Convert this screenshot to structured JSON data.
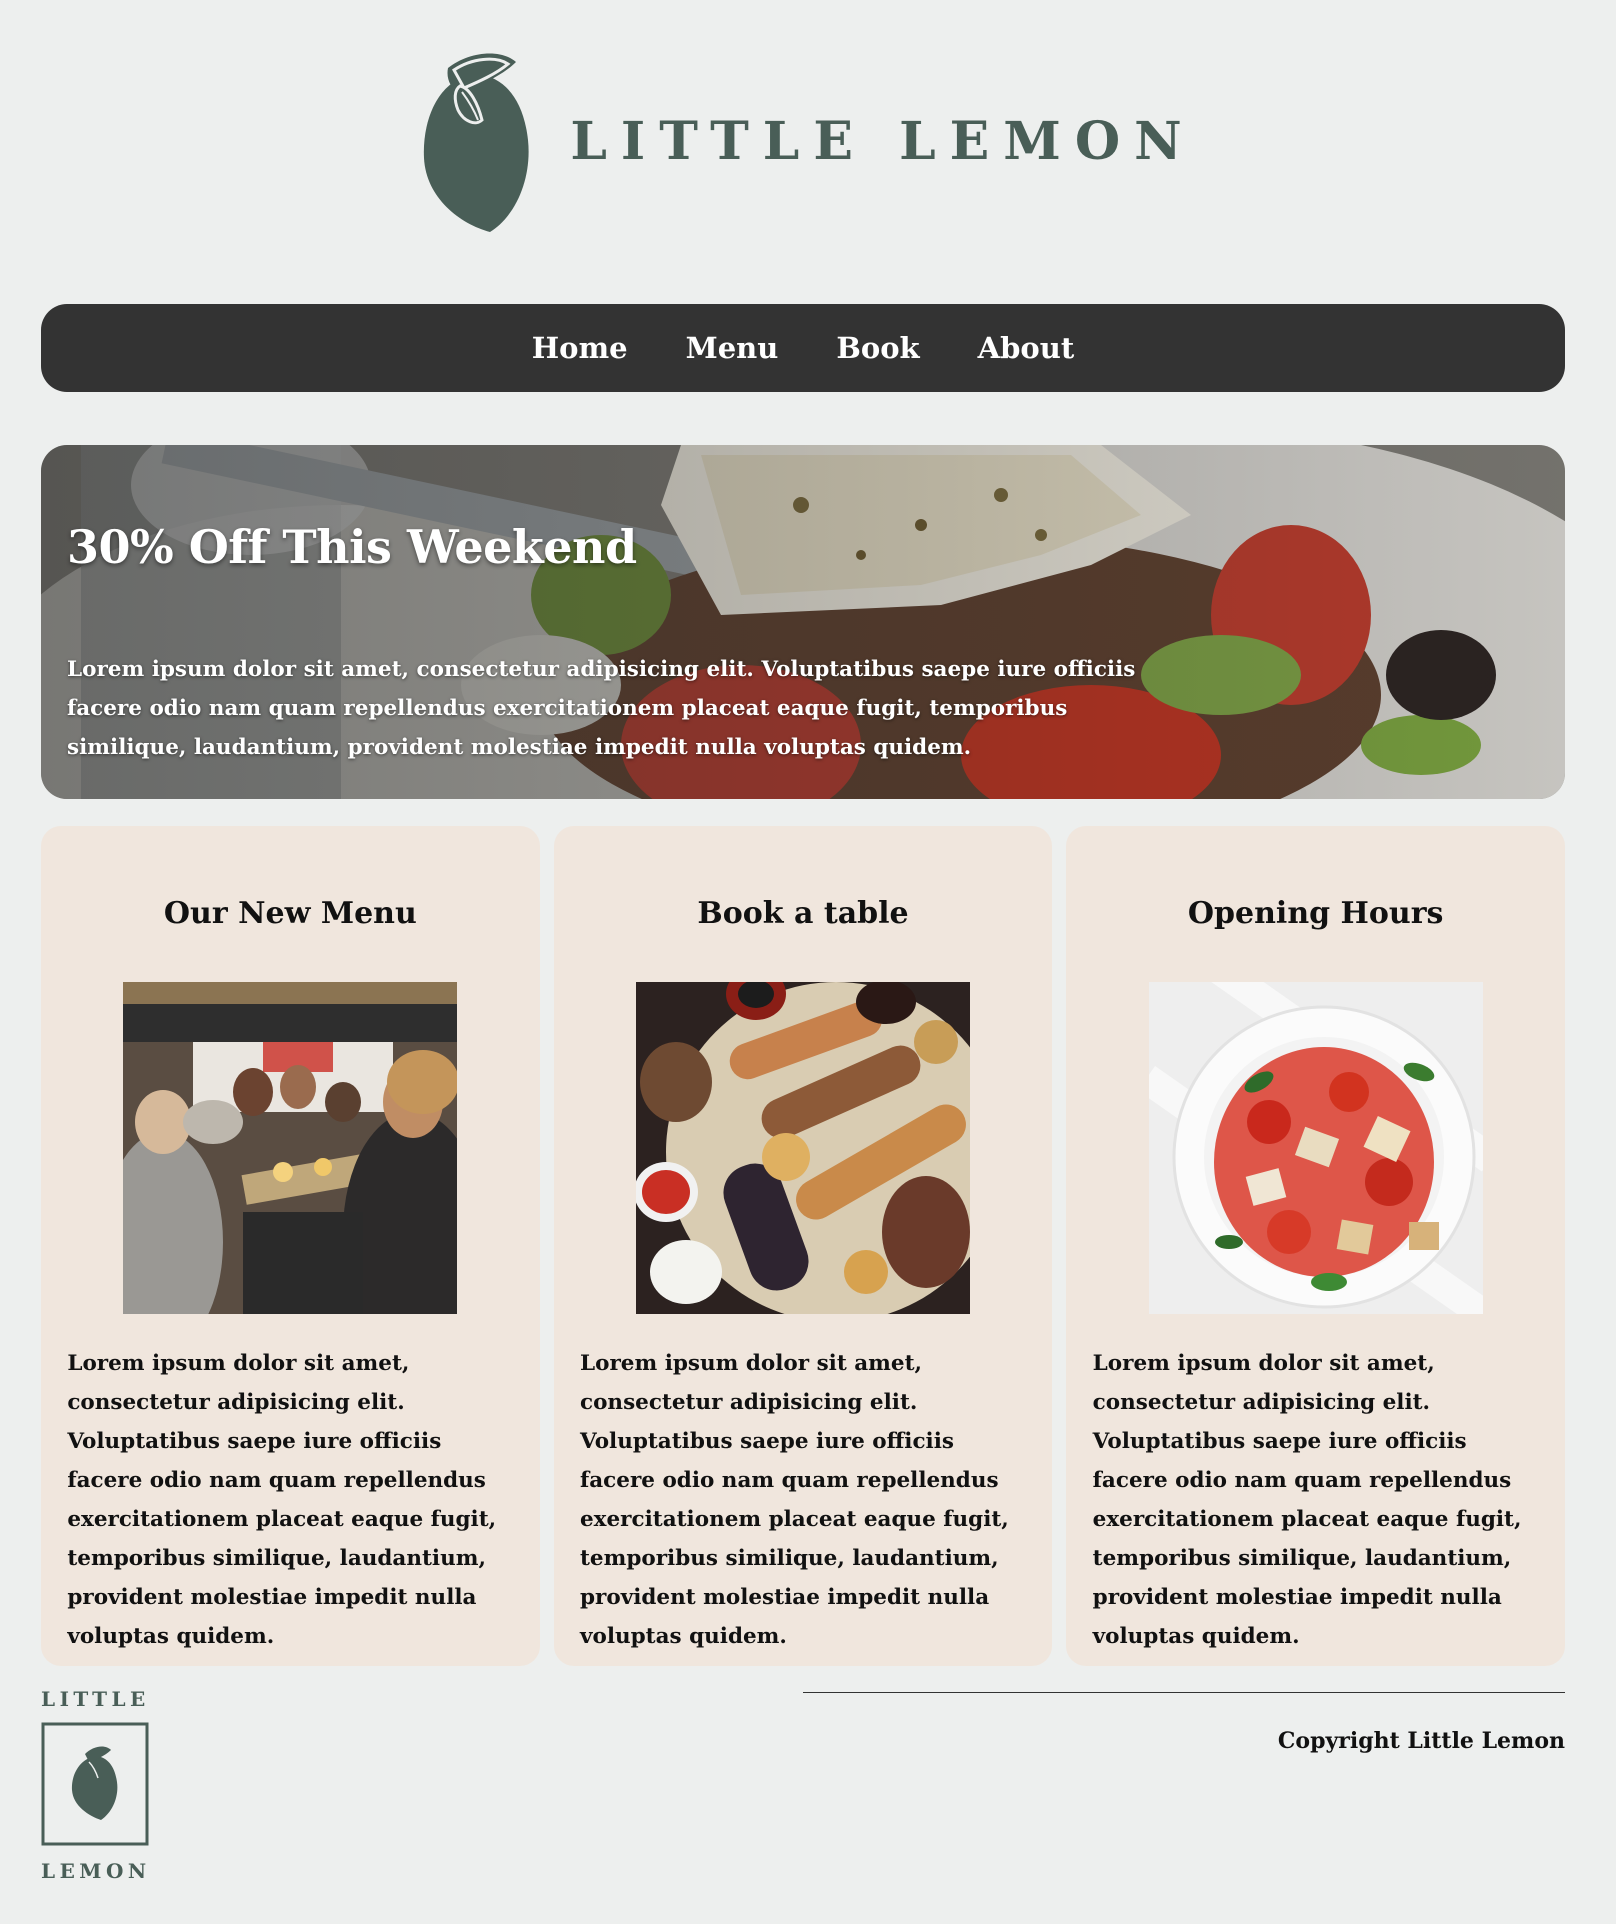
{
  "brand": {
    "name": "LITTLE LEMON",
    "footer_top": "LITTLE",
    "footer_bottom": "LEMON"
  },
  "nav": {
    "items": [
      "Home",
      "Menu",
      "Book",
      "About"
    ]
  },
  "hero": {
    "title": "30% Off This Weekend",
    "text": "Lorem ipsum dolor sit amet, consectetur adipisicing elit. Voluptatibus saepe iure officiis facere odio nam quam repellendus exercitationem placeat eaque fugit, temporibus similique, laudantium, provident molestiae impedit nulla voluptas quidem."
  },
  "cards": [
    {
      "title": "Our New Menu",
      "text": "Lorem ipsum dolor sit amet, consectetur adipisicing elit. Voluptatibus saepe iure officiis facere odio nam quam repellendus exercitationem placeat eaque fugit, temporibus similique, laudantium, provident molestiae impedit nulla voluptas quidem."
    },
    {
      "title": "Book a table",
      "text": "Lorem ipsum dolor sit amet, consectetur adipisicing elit. Voluptatibus saepe iure officiis facere odio nam quam repellendus exercitationem placeat eaque fugit, temporibus similique, laudantium, provident molestiae impedit nulla voluptas quidem."
    },
    {
      "title": "Opening Hours",
      "text": "Lorem ipsum dolor sit amet, consectetur adipisicing elit. Voluptatibus saepe iure officiis facere odio nam quam repellendus exercitationem placeat eaque fugit, temporibus similique, laudantium, provident molestiae impedit nulla voluptas quidem."
    }
  ],
  "footer": {
    "copyright": "Copyright Little Lemon"
  },
  "colors": {
    "brand_green": "#495e57",
    "nav_bg": "#333333",
    "card_bg": "#f0e6dd",
    "page_bg": "#edefee"
  }
}
